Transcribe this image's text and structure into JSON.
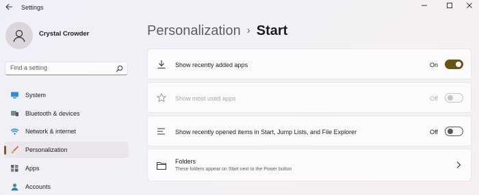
{
  "window": {
    "title": "Settings"
  },
  "user": {
    "name": "Crystal Crowder"
  },
  "search": {
    "placeholder": "Find a setting"
  },
  "sidebar": {
    "items": [
      {
        "label": "System",
        "icon": "system-icon"
      },
      {
        "label": "Bluetooth & devices",
        "icon": "bluetooth-icon"
      },
      {
        "label": "Network & internet",
        "icon": "wifi-icon"
      },
      {
        "label": "Personalization",
        "icon": "brush-icon",
        "active": true
      },
      {
        "label": "Apps",
        "icon": "apps-icon"
      },
      {
        "label": "Accounts",
        "icon": "accounts-icon"
      }
    ]
  },
  "breadcrumb": {
    "parent": "Personalization",
    "separator": "›",
    "current": "Start"
  },
  "settings": [
    {
      "label": "Show recently added apps",
      "state": "On",
      "enabled": true,
      "icon": "download-icon"
    },
    {
      "label": "Show most used apps",
      "state": "Off",
      "enabled": false,
      "icon": "star-icon"
    },
    {
      "label": "Show recently opened items in Start, Jump Lists, and File Explorer",
      "state": "Off",
      "enabled": true,
      "icon": "list-icon"
    },
    {
      "label": "Folders",
      "sublabel": "These folders appear on Start next to the Power button",
      "icon": "folder-icon"
    }
  ],
  "colors": {
    "accent": "#6b5316",
    "active_indicator": "#7a5d24"
  }
}
